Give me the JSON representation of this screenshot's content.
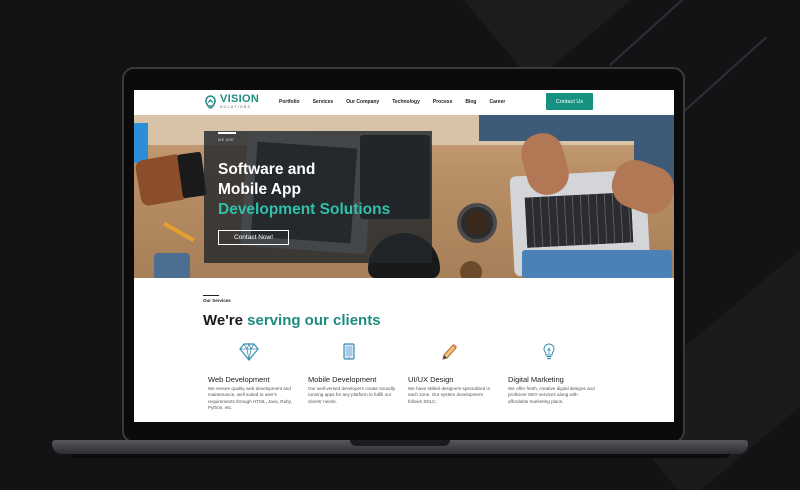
{
  "site": {
    "logo": {
      "title": "VISION",
      "subtitle": "SOLUTIONS"
    },
    "nav": {
      "items": [
        "Portfolio",
        "Services",
        "Our Company",
        "Technology",
        "Process",
        "Blog",
        "Career"
      ],
      "cta": "Contact Us"
    },
    "hero": {
      "tag": "WE ARE",
      "headline_line1": "Software and",
      "headline_line2": "Mobile App",
      "headline_line3": "Development Solutions",
      "button": "Contact Now!"
    },
    "services": {
      "label": "Our Services",
      "heading_plain": "We're",
      "heading_accent": "serving our clients",
      "cards": [
        {
          "icon": "diamond-icon",
          "title": "Web Development",
          "text": "We ensure quality web development and maintenance, well suited to user's requirements through HTML, Java, Ruby, Python, etc."
        },
        {
          "icon": "tablet-icon",
          "title": "Mobile Development",
          "text": "Our well-versed developers create soundly running apps for any platform to fulfill our clients' needs."
        },
        {
          "icon": "pencil-icon",
          "title": "UI/UX Design",
          "text": "We have skilled designers specialized in each zone. Our system development follows SDLC."
        },
        {
          "icon": "lightbulb-icon",
          "title": "Digital Marketing",
          "text": "We offer fresh, creative digital designs and proficient SEO services along with affordable marketing plans."
        }
      ]
    }
  },
  "colors": {
    "accent": "#1e8c80",
    "hero_accent": "#2fc0ac",
    "button": "#17917f",
    "background": "#121314"
  }
}
